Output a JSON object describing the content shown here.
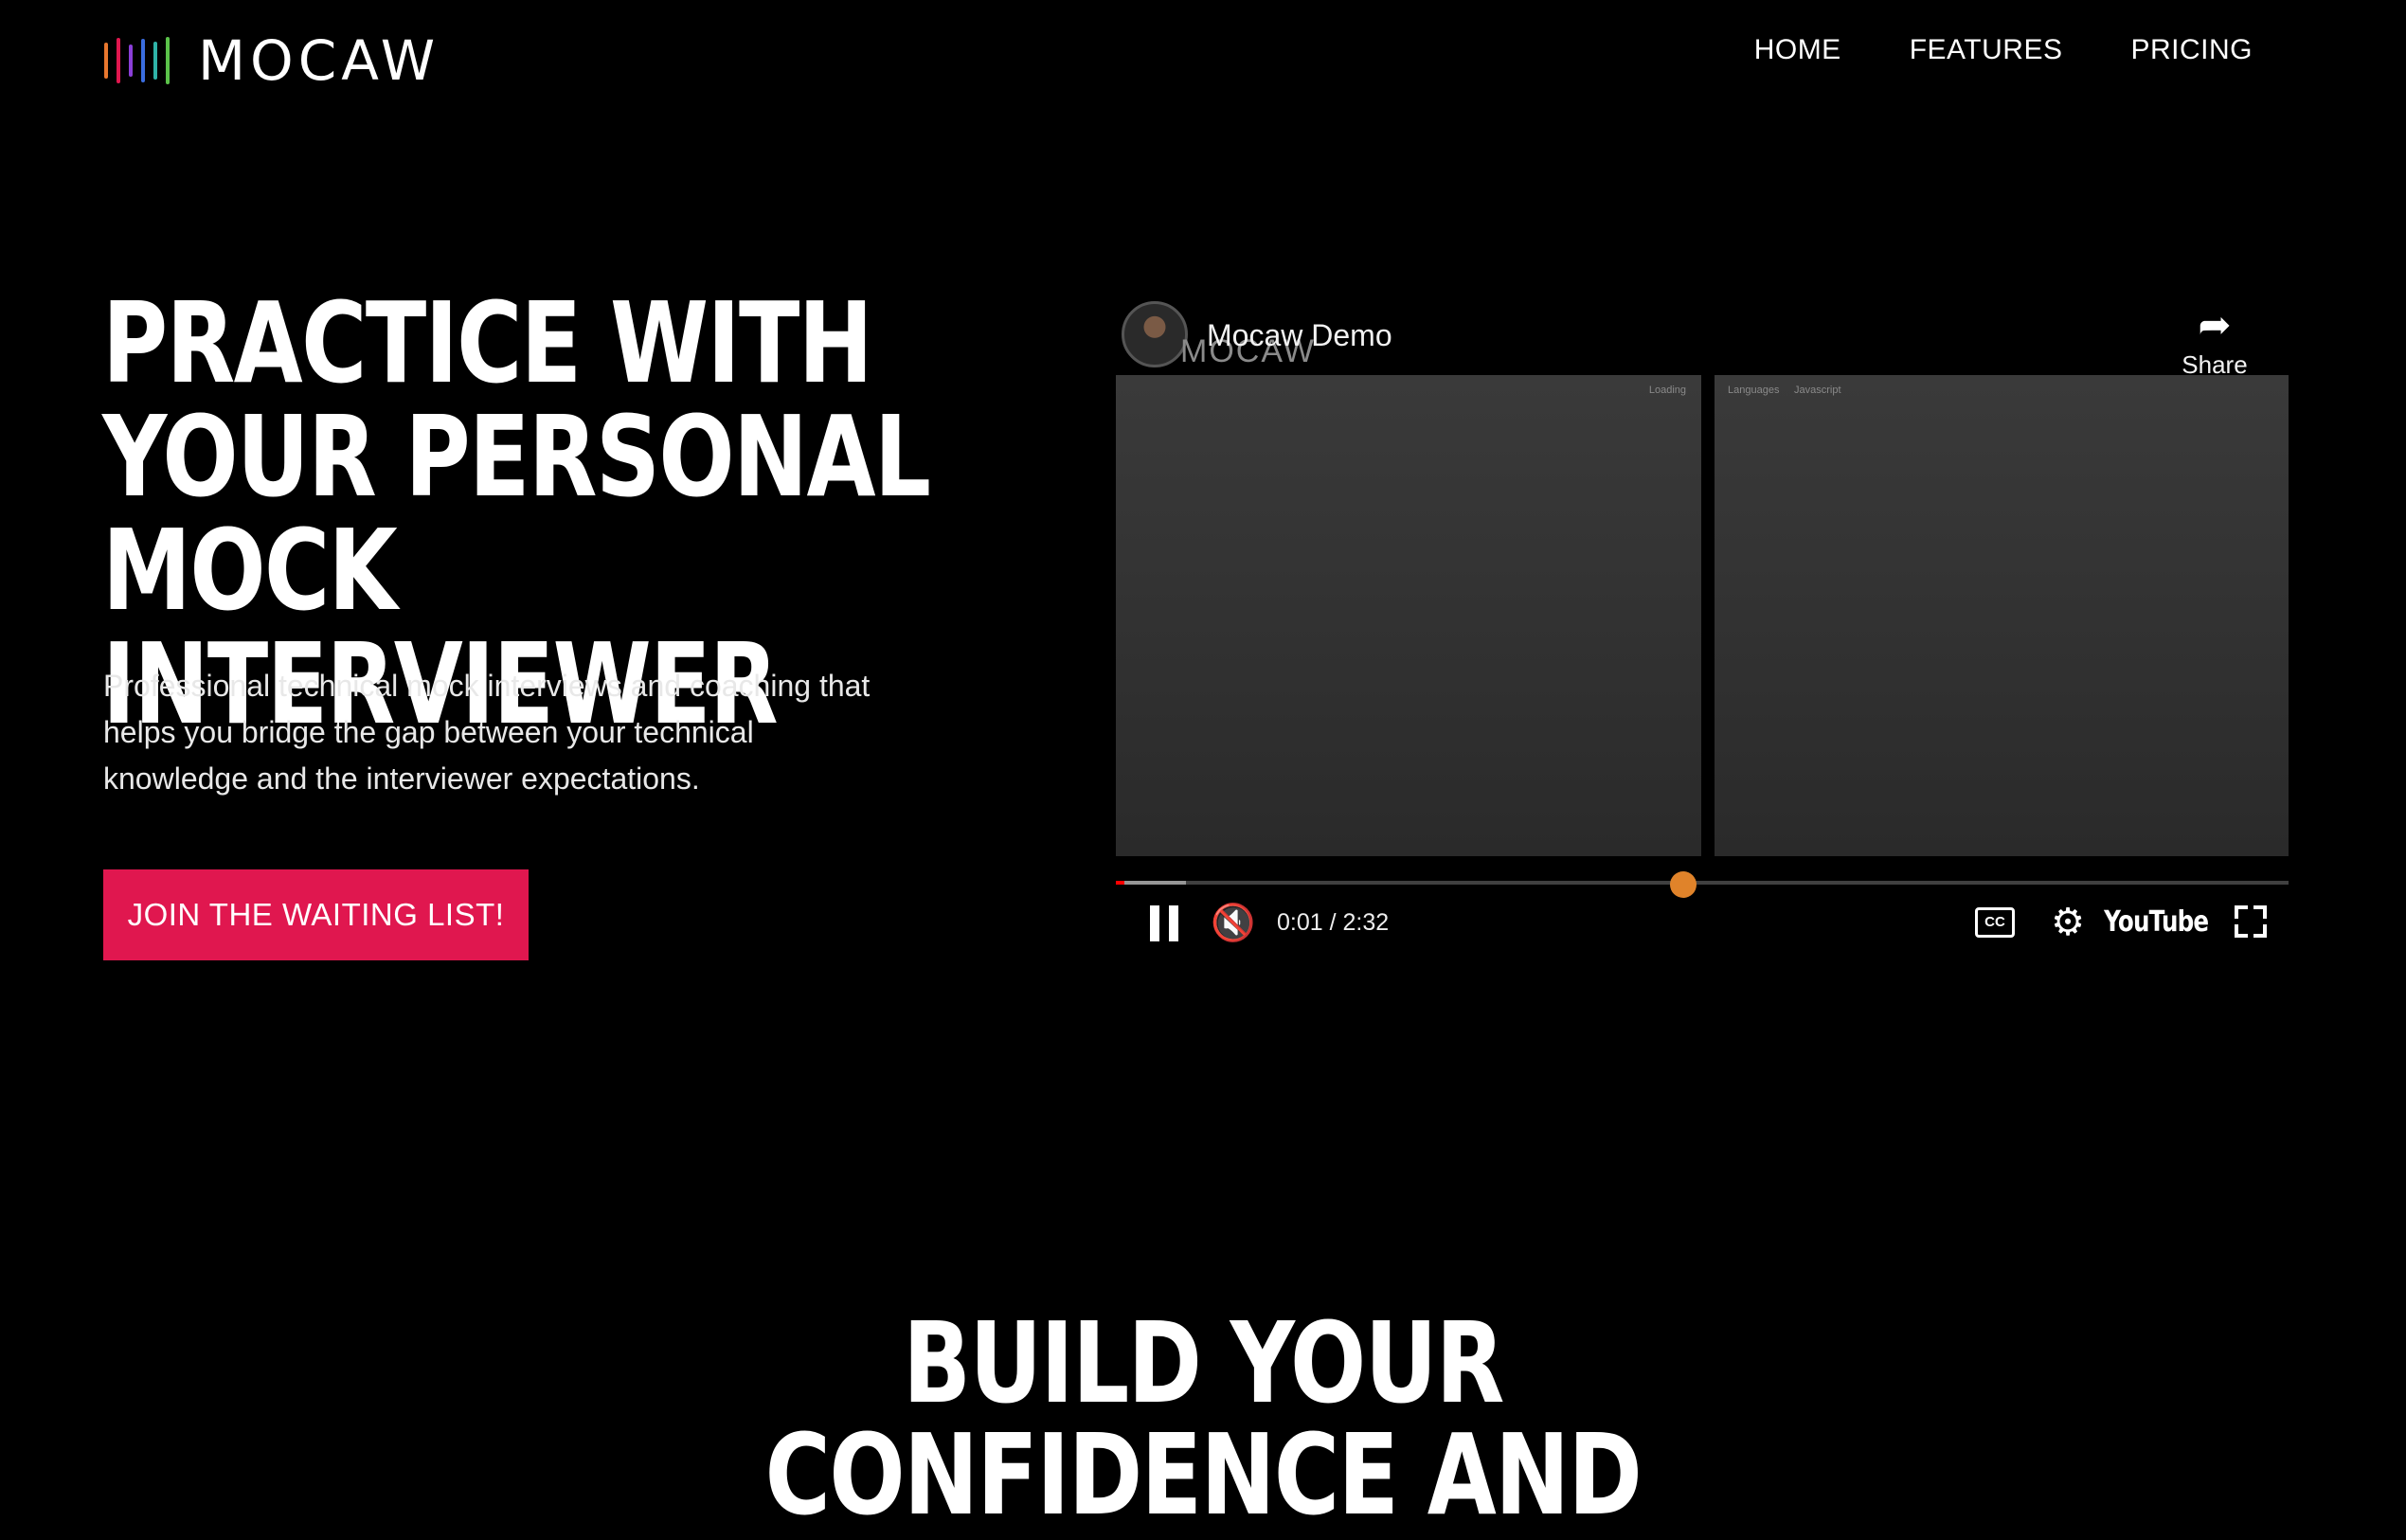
{
  "brand": {
    "name": "MOCAW",
    "bar_colors": [
      "#e8772e",
      "#e0174f",
      "#8b3fd9",
      "#3a6de0",
      "#2fb3a8",
      "#5bc24a"
    ]
  },
  "nav": {
    "links": [
      {
        "label": "HOME"
      },
      {
        "label": "FEATURES"
      },
      {
        "label": "PRICING"
      }
    ]
  },
  "hero": {
    "title_lines": [
      "PRACTICE WITH",
      "YOUR PERSONAL",
      "MOCK INTERVIEWER"
    ],
    "subtitle": "Professional technical mock interviews and coaching that helps you bridge the gap between your technical knowledge and the interviewer expectations.",
    "cta_label": "JOIN THE WAITING LIST!",
    "cta_color": "#e0174f"
  },
  "video": {
    "title": "Mocaw Demo",
    "watermark": "MOCAW",
    "share_label": "Share",
    "panel_left_label": "Loading",
    "panel_right_label_1": "Languages",
    "panel_right_label_2": "Javascript",
    "time_display": "0:01 / 2:32",
    "progress_played_fraction": 0.007,
    "progress_buffered_fraction": 0.06,
    "brand_label": "YouTube",
    "cc_label": "CC",
    "icons": [
      "share-icon",
      "pause-icon",
      "mute-icon",
      "cc-icon",
      "settings-icon",
      "fullscreen-icon"
    ]
  },
  "section2": {
    "title_lines": [
      "BUILD YOUR",
      "CONFIDENCE AND"
    ]
  }
}
